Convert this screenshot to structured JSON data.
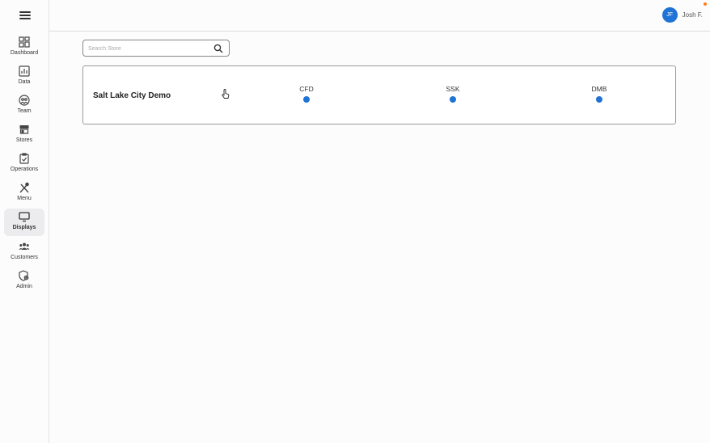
{
  "nav": {
    "items": [
      {
        "label": "Dashboard",
        "icon": "dashboard-icon",
        "active": false
      },
      {
        "label": "Data",
        "icon": "data-chart-icon",
        "active": false
      },
      {
        "label": "Team",
        "icon": "team-icon",
        "active": false
      },
      {
        "label": "Stores",
        "icon": "store-icon",
        "active": false
      },
      {
        "label": "Operations",
        "icon": "clipboard-check-icon",
        "active": false
      },
      {
        "label": "Menu",
        "icon": "utensils-icon",
        "active": false
      },
      {
        "label": "Displays",
        "icon": "monitor-icon",
        "active": true
      },
      {
        "label": "Customers",
        "icon": "customers-icon",
        "active": false
      },
      {
        "label": "Admin",
        "icon": "admin-shield-icon",
        "active": false
      }
    ]
  },
  "header": {
    "user_initials": "JF",
    "user_name": "Josh F."
  },
  "search": {
    "placeholder": "Search Store",
    "value": ""
  },
  "store": {
    "name": "Salt Lake City Demo",
    "devices": [
      {
        "label": "CFD",
        "status_color": "#1f73d6"
      },
      {
        "label": "SSK",
        "status_color": "#1f73d6"
      },
      {
        "label": "DMB",
        "status_color": "#1f73d6"
      }
    ]
  },
  "colors": {
    "accent": "#1f73d6",
    "notification": "#ff7a1a"
  }
}
